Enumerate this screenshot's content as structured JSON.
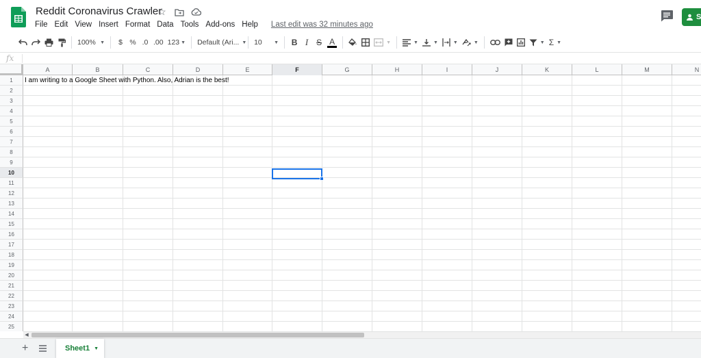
{
  "app": {
    "doc_title": "Reddit Coronavirus Crawler",
    "last_edit": "Last edit was 32 minutes ago",
    "share_label": "S"
  },
  "menu": [
    "File",
    "Edit",
    "View",
    "Insert",
    "Format",
    "Data",
    "Tools",
    "Add-ons",
    "Help"
  ],
  "toolbar": {
    "zoom": "100%",
    "currency": "$",
    "percent": "%",
    "decrease_decimals": ".0",
    "increase_decimals": ".00",
    "more_formats": "123",
    "font_family": "Default (Ari...",
    "font_size": "10",
    "bold": "B",
    "italic": "I",
    "strikethrough": "S",
    "text_color": "A",
    "text_color_value": "#000000",
    "functions": "Σ"
  },
  "formula_bar": {
    "fx_label": "fx",
    "value": ""
  },
  "grid": {
    "columns": [
      "A",
      "B",
      "C",
      "D",
      "E",
      "F",
      "G",
      "H",
      "I",
      "J",
      "K",
      "L",
      "M",
      "N"
    ],
    "rows": [
      "1",
      "2",
      "3",
      "4",
      "5",
      "6",
      "7",
      "8",
      "9",
      "10",
      "11",
      "12",
      "13",
      "14",
      "15",
      "16",
      "17",
      "18",
      "19",
      "20",
      "21",
      "22",
      "23",
      "24",
      "25"
    ],
    "selected_cell": "F10",
    "cells": {
      "A1": "I am writing to a Google Sheet with Python. Also, Adrian is the best!"
    }
  },
  "sheets": {
    "add_label": "+",
    "tabs": [
      "Sheet1"
    ],
    "active": "Sheet1"
  },
  "colors": {
    "brand_green": "#188038",
    "share_green": "#1e8e3e",
    "selection_blue": "#1a73e8"
  }
}
